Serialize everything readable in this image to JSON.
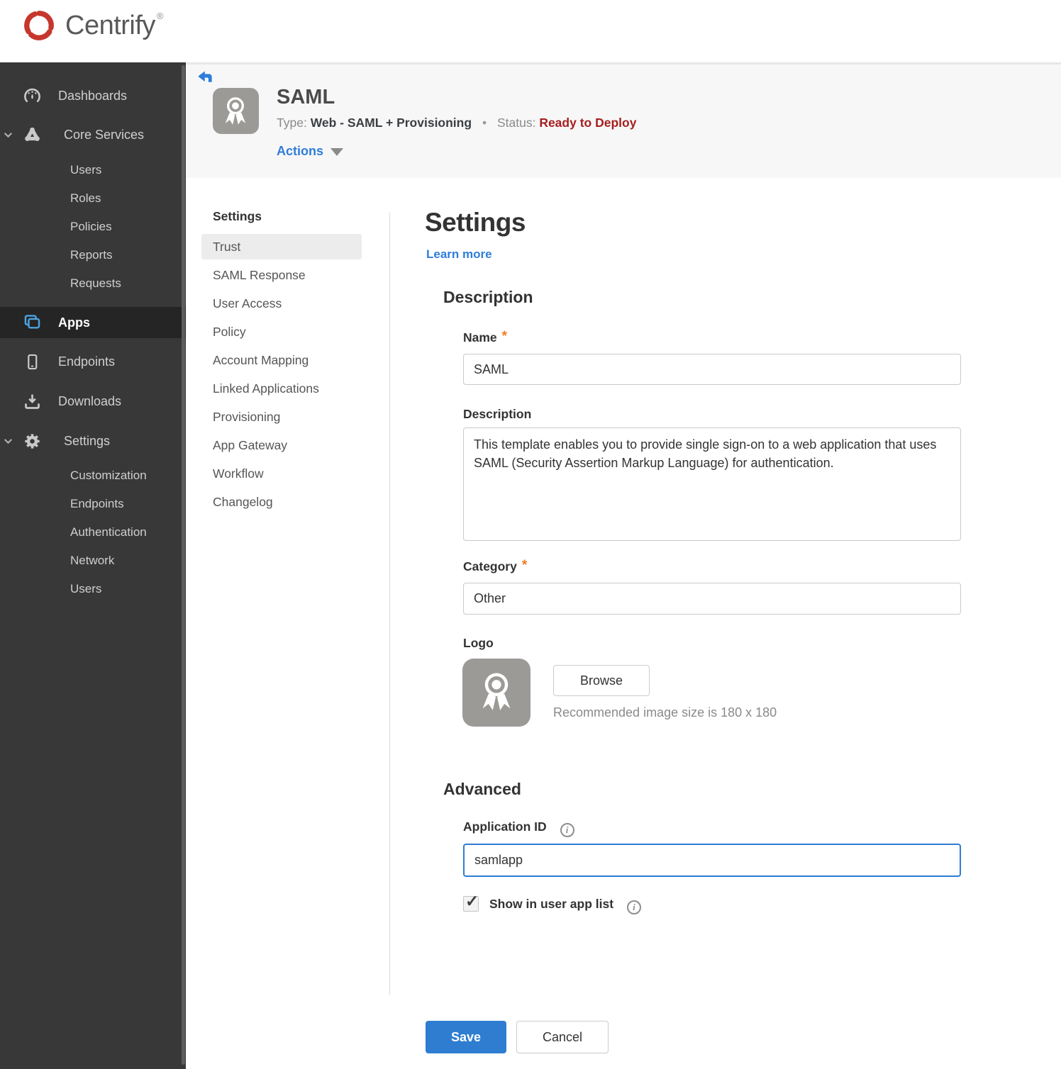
{
  "brand": {
    "name": "Centrify",
    "registered_mark": "®"
  },
  "sidebar": {
    "items": [
      {
        "label": "Dashboards"
      },
      {
        "label": "Core Services",
        "expanded": true
      },
      {
        "label": "Users"
      },
      {
        "label": "Roles"
      },
      {
        "label": "Policies"
      },
      {
        "label": "Reports"
      },
      {
        "label": "Requests"
      },
      {
        "label": "Apps",
        "active": true
      },
      {
        "label": "Endpoints"
      },
      {
        "label": "Downloads"
      },
      {
        "label": "Settings",
        "expanded": true
      },
      {
        "label": "Customization"
      },
      {
        "label": "Endpoints"
      },
      {
        "label": "Authentication"
      },
      {
        "label": "Network"
      },
      {
        "label": "Users"
      }
    ]
  },
  "app_header": {
    "app_name": "SAML",
    "type_label": "Type:",
    "type_value": "Web - SAML + Provisioning",
    "separator": "•",
    "status_label": "Status:",
    "status_value": "Ready to Deploy",
    "actions_label": "Actions"
  },
  "subnav": {
    "title": "Settings",
    "selected": "Trust",
    "items": [
      {
        "label": "Trust",
        "selected": true
      },
      {
        "label": "SAML Response"
      },
      {
        "label": "User Access"
      },
      {
        "label": "Policy"
      },
      {
        "label": "Account Mapping"
      },
      {
        "label": "Linked Applications"
      },
      {
        "label": "Provisioning"
      },
      {
        "label": "App Gateway"
      },
      {
        "label": "Workflow"
      },
      {
        "label": "Changelog"
      }
    ]
  },
  "main": {
    "title": "Settings",
    "learn_more_label": "Learn more",
    "required_marker": "*",
    "description_section": {
      "heading": "Description",
      "name_label": "Name",
      "name_value": "SAML",
      "description_label": "Description",
      "description_value": "This template enables you to provide single sign-on to a web application that uses SAML (Security Assertion Markup Language) for authentication.",
      "category_label": "Category",
      "category_value": "Other",
      "logo_label": "Logo",
      "browse_button_label": "Browse",
      "logo_hint": "Recommended image size is 180 x 180"
    },
    "advanced_section": {
      "heading": "Advanced",
      "application_id_label": "Application ID",
      "application_id_value": "samlapp",
      "show_in_user_app_list_label": "Show in user app list",
      "checkbox_checked": true
    },
    "footer": {
      "save_label": "Save",
      "cancel_label": "Cancel"
    }
  },
  "icons": {
    "checkmark": "✓",
    "info_glyph": "i"
  },
  "colors": {
    "accent_blue": "#2f7ddb",
    "save_blue": "#2e7dd1",
    "status_red": "#a61e1e",
    "required_orange": "#f47b20",
    "apps_icon_blue": "#4aa3e0",
    "brand_red": "#c6362c",
    "sidebar_bg": "#383838",
    "sidebar_active_bg": "#252525",
    "header_band_bg": "#f7f7f7"
  }
}
